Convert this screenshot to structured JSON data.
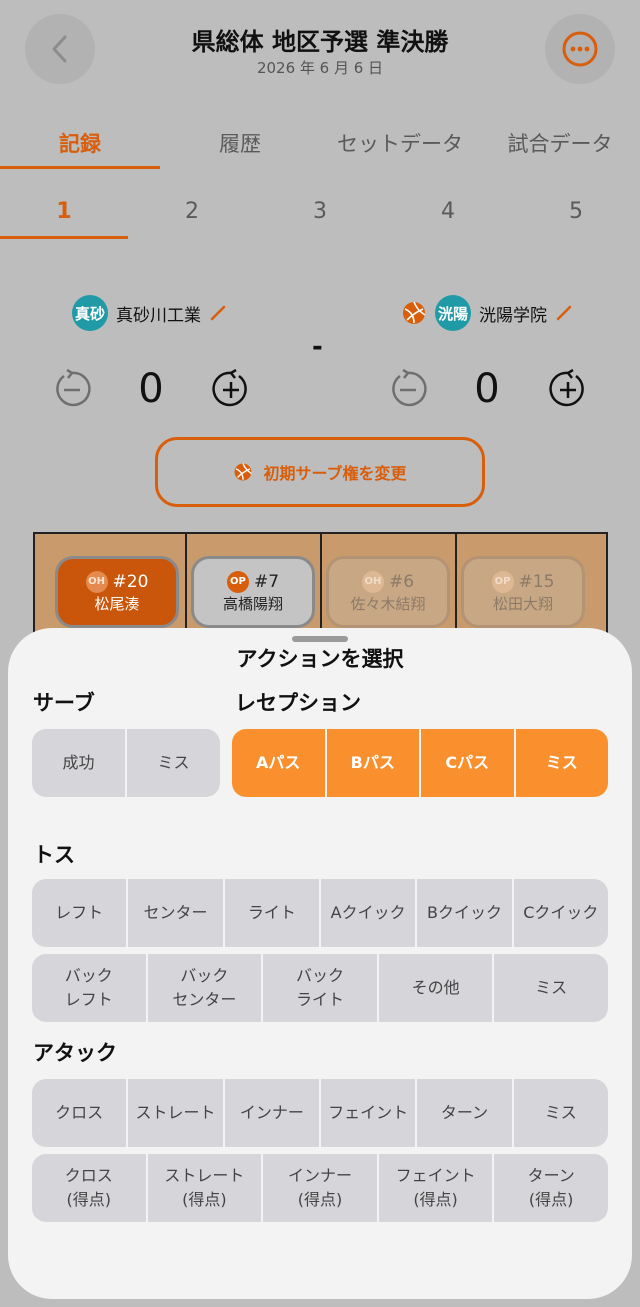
{
  "header": {
    "title": "県総体 地区予選 準決勝",
    "date": "2026 年 6 月 6 日"
  },
  "tabs": [
    "記録",
    "履歴",
    "セットデータ",
    "試合データ"
  ],
  "sets": [
    "1",
    "2",
    "3",
    "4",
    "5"
  ],
  "teams": {
    "home": {
      "badge": "真砂",
      "name": "真砂川工業",
      "score": "0"
    },
    "away": {
      "badge": "洸陽",
      "name": "洸陽学院",
      "score": "0"
    },
    "separator": "-"
  },
  "serve_change_label": "初期サーブ権を変更",
  "players": [
    {
      "pos": "OH",
      "number": "#20",
      "name": "松尾湊"
    },
    {
      "pos": "OP",
      "number": "#7",
      "name": "高橋陽翔"
    },
    {
      "pos": "OH",
      "number": "#6",
      "name": "佐々木結翔"
    },
    {
      "pos": "OP",
      "number": "#15",
      "name": "松田大翔"
    }
  ],
  "sheet": {
    "title": "アクションを選択",
    "serve": {
      "label": "サーブ",
      "buttons": [
        "成功",
        "ミス"
      ]
    },
    "reception": {
      "label": "レセプション",
      "buttons": [
        "Aパス",
        "Bパス",
        "Cパス",
        "ミス"
      ]
    },
    "toss": {
      "label": "トス",
      "row1": [
        "レフト",
        "センター",
        "ライト",
        "Aクイック",
        "Bクイック",
        "Cクイック"
      ],
      "row2": [
        [
          "バック",
          "レフト"
        ],
        [
          "バック",
          "センター"
        ],
        [
          "バック",
          "ライト"
        ],
        [
          "その他"
        ],
        [
          "ミス"
        ]
      ]
    },
    "attack": {
      "label": "アタック",
      "row1": [
        "クロス",
        "ストレート",
        "インナー",
        "フェイント",
        "ターン",
        "ミス"
      ],
      "row2": [
        [
          "クロス",
          "(得点)"
        ],
        [
          "ストレート",
          "(得点)"
        ],
        [
          "インナー",
          "(得点)"
        ],
        [
          "フェイント",
          "(得点)"
        ],
        [
          "ターン",
          "(得点)"
        ]
      ]
    }
  },
  "colors": {
    "accent": "#d85e0c",
    "orange_button": "#f9902d",
    "team_badge": "#1f9aa6"
  }
}
